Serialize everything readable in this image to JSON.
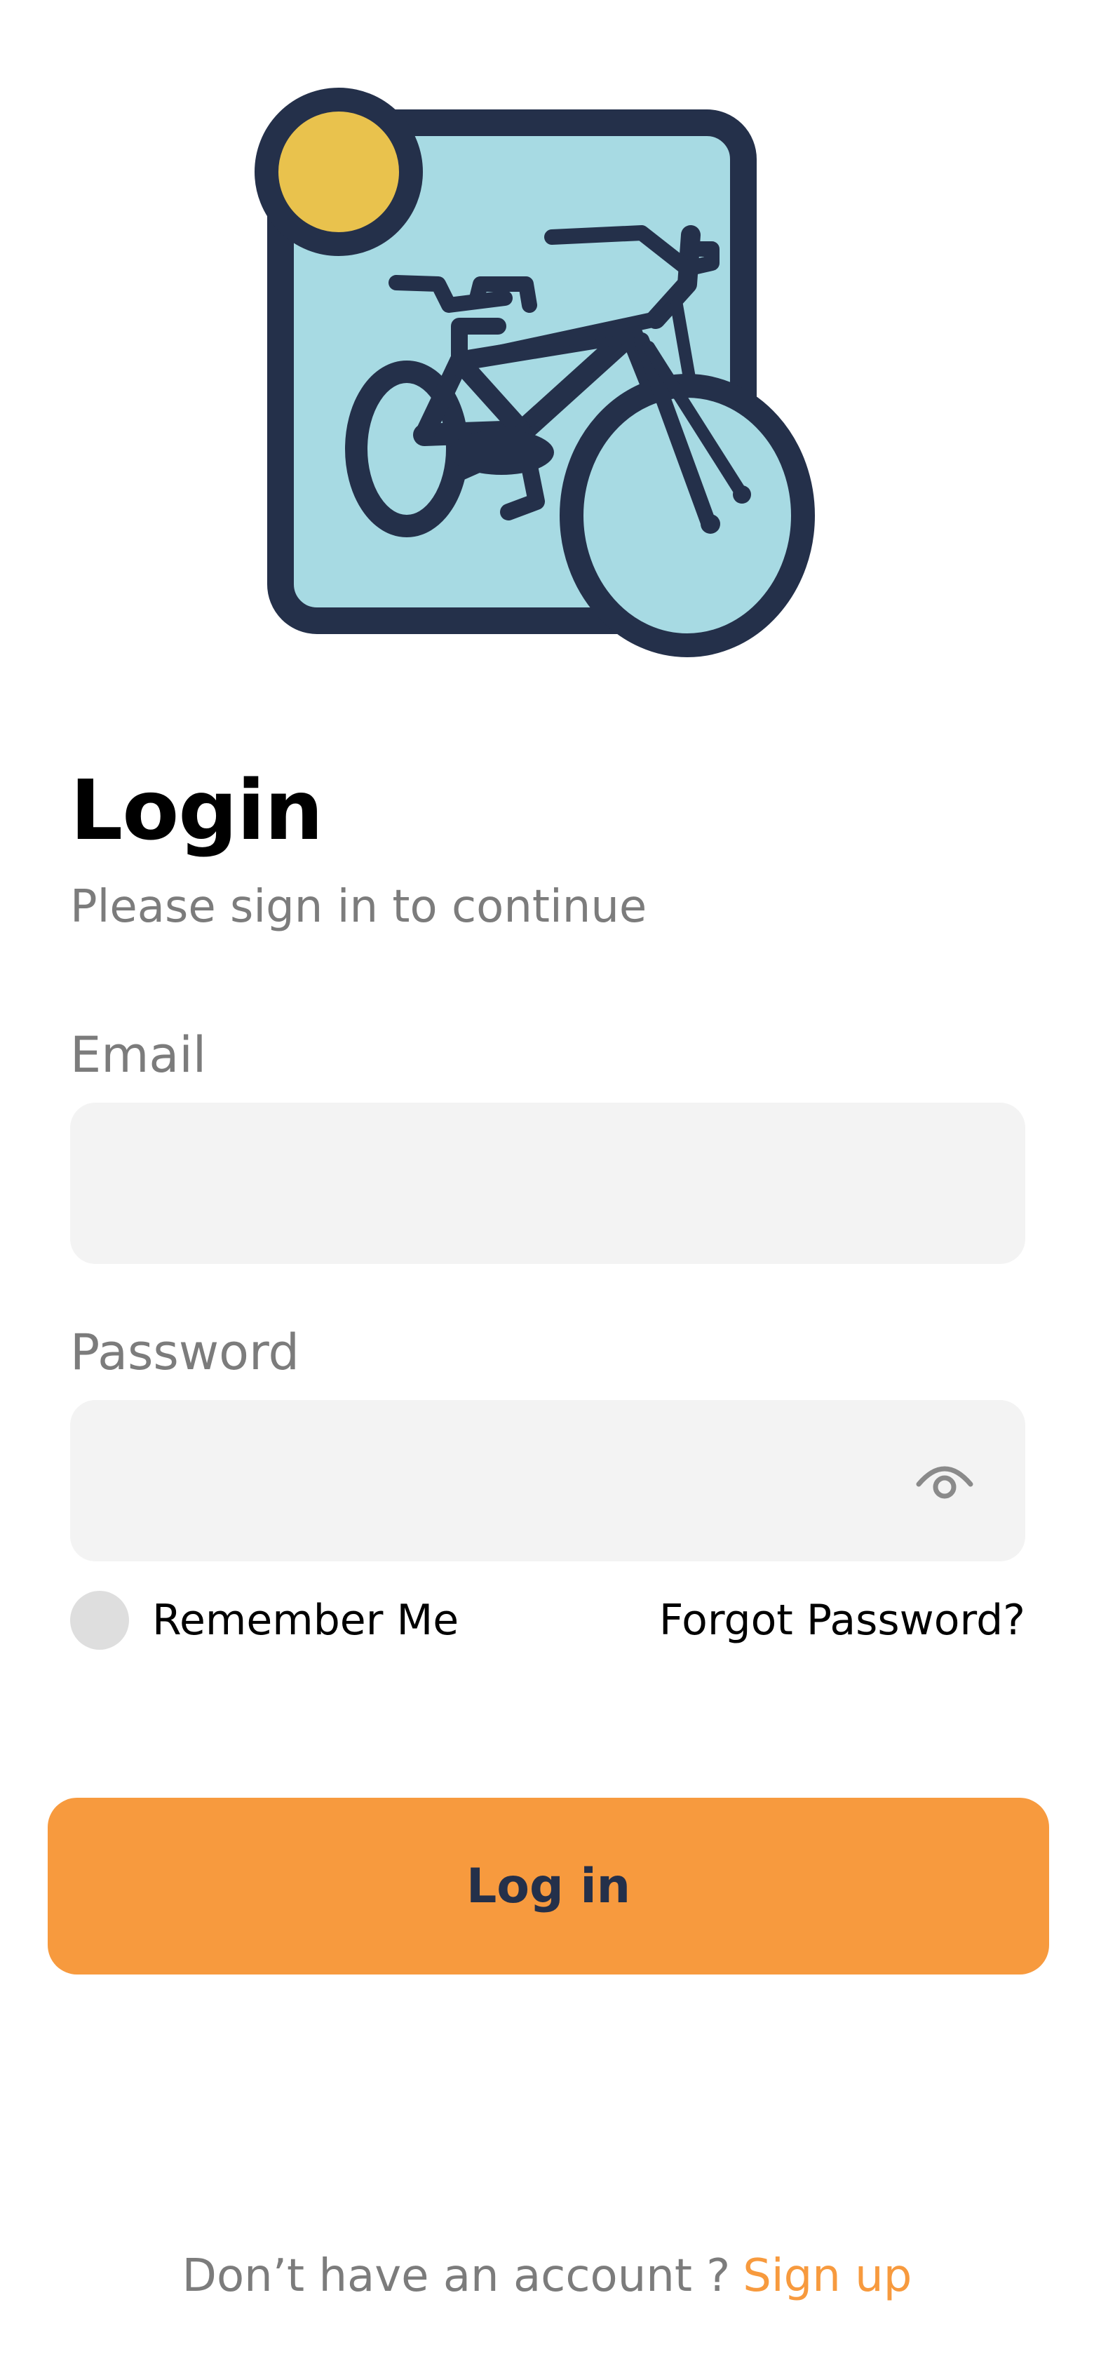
{
  "header": {
    "logo_icon": "bicycle-logo-icon",
    "title": "Login",
    "subtitle": "Please sign in to continue"
  },
  "form": {
    "email": {
      "label": "Email",
      "value": "",
      "placeholder": ""
    },
    "password": {
      "label": "Password",
      "value": "",
      "placeholder": "",
      "toggle_icon": "eye-icon"
    },
    "remember_me": {
      "label": "Remember Me",
      "checked": false
    },
    "forgot_password_label": "Forgot Password?",
    "submit_label": "Log in"
  },
  "footer": {
    "prompt": "Don’t have an account ?",
    "signup_label": "Sign up"
  },
  "colors": {
    "accent": "#f79a3e",
    "logo_tile": "#a7dae3",
    "logo_outline": "#24304a",
    "logo_sun": "#e9c24d",
    "field_background": "#f3f3f3",
    "muted_text": "#7c7c7c"
  }
}
